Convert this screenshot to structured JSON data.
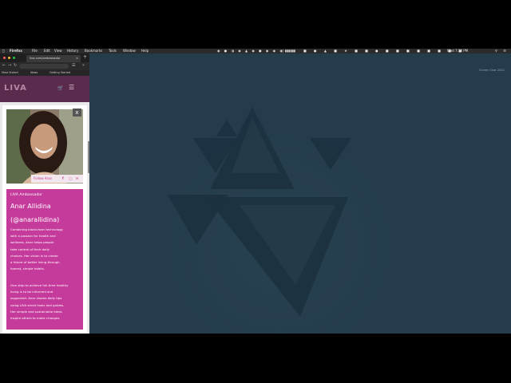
{
  "menubar": {
    "app_name": "Firefox",
    "menus": [
      "File",
      "Edit",
      "View",
      "History",
      "Bookmarks",
      "Tools",
      "Window",
      "Help"
    ],
    "status_text": "Wed 7:38 PM"
  },
  "browser": {
    "tab_title": "liva.com/ambassador",
    "new_tab_label": "+",
    "bookmarks": [
      "Most Visited",
      "News",
      "Getting Started"
    ],
    "site": {
      "logo": "LIVA",
      "ambassador": {
        "close_label": "x",
        "social_label": "Follow Anar",
        "role": "LIVA Ambassador",
        "name": "Anar Allidina",
        "handle": "(@anarallidina)",
        "bio_lines": [
          "Combining blockchain technology",
          "with a passion for health and",
          "wellness, Anar helps people",
          "take control of their daily",
          "choices. Her vision is to create",
          "a future of better living through",
          "honest, simple habits."
        ],
        "bio2_lines": [
          "One step to achieve full-time healthy",
          "living is to be informed and",
          "supported. Anar shares daily tips",
          "using LIVA smart tools and guides.",
          "Her simple and sustainable ideas",
          "inspire others to make changes."
        ]
      }
    }
  },
  "desktop": {
    "label": "Screen Shot 2021"
  },
  "colors": {
    "desktop": "#243c4c",
    "triangle": "#1c3140",
    "header": "#5b2b4e",
    "panel": "#c53b9c"
  },
  "icons": [
    "apple-icon",
    "cart-icon",
    "hamburger-menu-icon",
    "close-icon",
    "facebook-icon",
    "instagram-icon",
    "email-icon"
  ]
}
